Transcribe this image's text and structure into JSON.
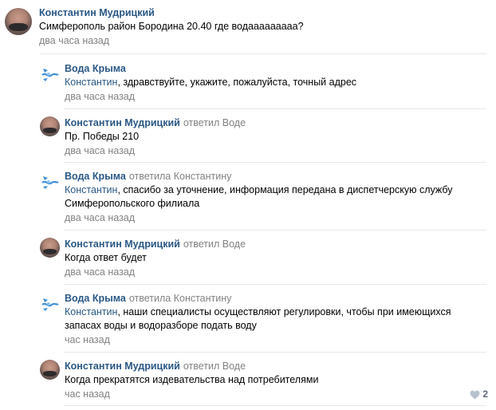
{
  "root": {
    "author": "Константин Мудрицкий",
    "text": "Симферополь район Бородина 20.40 где водааааааааа?",
    "date": "два часа назад"
  },
  "replies": [
    {
      "author": "Вода Крыма",
      "reply_to": "",
      "mention": "Константин",
      "text": ", здравствуйте, укажите, пожалуйста, точный адрес",
      "date": "два часа назад"
    },
    {
      "author": "Константин Мудрицкий",
      "reply_to": "ответил Воде",
      "mention": "",
      "text": "Пр. Победы 210",
      "date": "два часа назад"
    },
    {
      "author": "Вода Крыма",
      "reply_to": "ответила Константину",
      "mention": "Константин",
      "text": ", спасибо за уточнение, информация передана в диспетчерскую службу Симферопольского филиала",
      "date": "два часа назад"
    },
    {
      "author": "Константин Мудрицкий",
      "reply_to": "ответил Воде",
      "mention": "",
      "text": "Когда ответ будет",
      "date": "два часа назад"
    },
    {
      "author": "Вода Крыма",
      "reply_to": "ответила Константину",
      "mention": "Константин",
      "text": ", наши специалисты осуществляют регулировки, чтобы при имеющихся запасах воды и водоразборе подать воду",
      "date": "час назад"
    },
    {
      "author": "Константин Мудрицкий",
      "reply_to": "ответил Воде",
      "mention": "",
      "text": "Когда прекратятся издевательства над потребителями",
      "date": "час назад",
      "likes": "2"
    }
  ],
  "icons": {
    "brand_logo": "voda-kryma-logo-icon",
    "like": "heart-icon"
  },
  "colors": {
    "link": "#2a5885",
    "meta": "#828282",
    "divider": "#e7e8ec",
    "brand": "#3f8fd6"
  }
}
